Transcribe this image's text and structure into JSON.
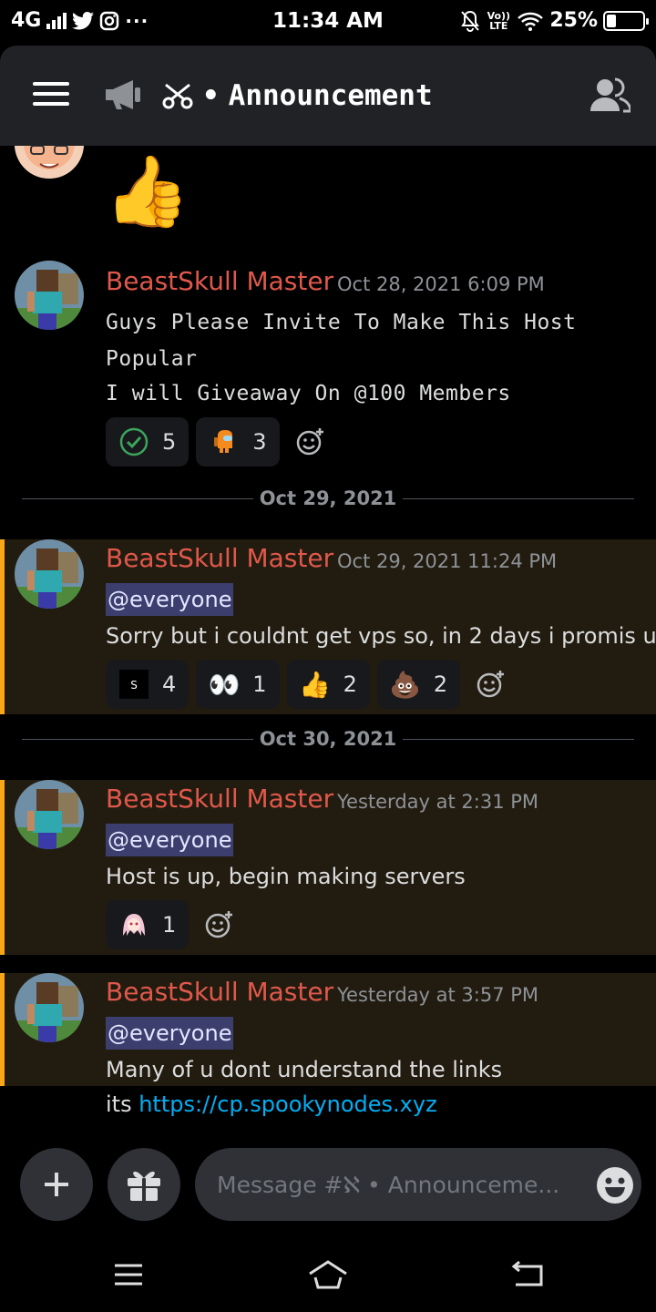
{
  "status_bar": {
    "network": "4G",
    "time": "11:34 AM",
    "volte": "Vo)) LTE",
    "battery_percent": "25%",
    "battery_level": 0.25,
    "icons": [
      "signal-icon",
      "twitter-icon",
      "instagram-icon",
      "more-icon",
      "mute-icon",
      "wifi-icon",
      "battery-icon"
    ]
  },
  "header": {
    "channel_name": "Announcement",
    "separator": "•",
    "icons": [
      "menu-icon",
      "megaphone-icon",
      "channel-glyph-icon",
      "members-icon"
    ]
  },
  "messages": [
    {
      "partial": true,
      "content": "👍"
    },
    {
      "author": "BeastSkull Master",
      "timestamp": "Oct 28, 2021 6:09 PM",
      "lines": [
        "Guys Please Invite To Make This Host",
        "Popular",
        "I will Giveaway On @100 Members"
      ],
      "reactions": [
        {
          "emoji": "check-icon",
          "count": "5"
        },
        {
          "emoji": "among-us-icon",
          "count": "3"
        }
      ]
    },
    {
      "divider": "Oct 29, 2021"
    },
    {
      "author": "BeastSkull Master",
      "timestamp": "Oct 29, 2021 11:24 PM",
      "mention": "@everyone",
      "lines": [
        "Sorry but i couldnt get vps so, in 2 days i promis u"
      ],
      "reactions": [
        {
          "emoji": "custom-s-icon",
          "count": "4"
        },
        {
          "emoji": "👀",
          "count": "1"
        },
        {
          "emoji": "👍",
          "count": "2"
        },
        {
          "emoji": "💩",
          "count": "2"
        }
      ]
    },
    {
      "divider": "Oct 30, 2021"
    },
    {
      "author": "BeastSkull Master",
      "timestamp": "Yesterday at 2:31 PM",
      "mention": "@everyone",
      "lines": [
        "Host is up, begin making servers"
      ],
      "reactions": [
        {
          "emoji": "anime-girl-icon",
          "count": "1"
        }
      ]
    },
    {
      "author": "BeastSkull Master",
      "timestamp": "Yesterday at 3:57 PM",
      "mention": "@everyone",
      "lines": [
        "Many of u dont understand the links"
      ],
      "link_prefix": "its ",
      "link": "https://cp.spookynodes.xyz"
    }
  ],
  "composer": {
    "placeholder": "Message #ℵ • Announceme...",
    "icons": [
      "plus-icon",
      "gift-icon",
      "emoji-icon"
    ]
  },
  "nav_bar": {
    "icons": [
      "recents-icon",
      "home-icon",
      "back-icon"
    ]
  },
  "colors": {
    "username": "#e0584b",
    "mention_bar": "#faa61a",
    "mention_bg": "#221c10",
    "mention_pill": "#3c3f6e",
    "link": "#00aff4",
    "header_bg": "#202225",
    "composer_bg": "#2f3136"
  }
}
